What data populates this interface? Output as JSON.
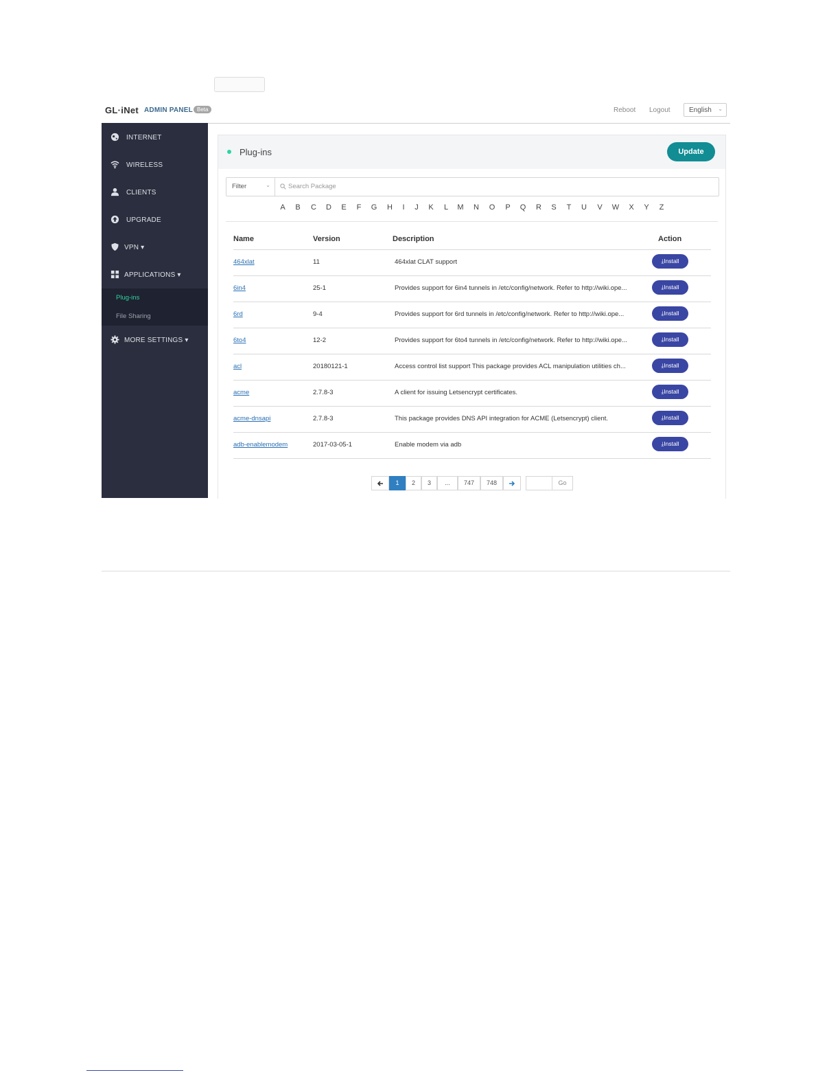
{
  "header": {
    "logo": "GL·iNet",
    "admin_panel": "ADMIN PANEL",
    "beta": "Beta",
    "reboot": "Reboot",
    "logout": "Logout",
    "language": "English"
  },
  "sidebar": {
    "items": [
      {
        "label": "INTERNET",
        "icon": "globe-icon"
      },
      {
        "label": "WIRELESS",
        "icon": "wifi-icon"
      },
      {
        "label": "CLIENTS",
        "icon": "user-icon"
      },
      {
        "label": "UPGRADE",
        "icon": "upgrade-icon"
      },
      {
        "label": "VPN ▾",
        "icon": "shield-icon"
      },
      {
        "label": "APPLICATIONS ▾",
        "icon": "grid-icon"
      },
      {
        "label": "MORE SETTINGS ▾",
        "icon": "gear-icon"
      }
    ],
    "submenu": [
      {
        "label": "Plug-ins",
        "active": true
      },
      {
        "label": "File Sharing",
        "active": false
      }
    ]
  },
  "panel": {
    "title": "Plug-ins",
    "update_label": "Update",
    "filter_label": "Filter",
    "search_placeholder": "Search Package",
    "letters": [
      "A",
      "B",
      "C",
      "D",
      "E",
      "F",
      "G",
      "H",
      "I",
      "J",
      "K",
      "L",
      "M",
      "N",
      "O",
      "P",
      "Q",
      "R",
      "S",
      "T",
      "U",
      "V",
      "W",
      "X",
      "Y",
      "Z"
    ],
    "columns": [
      "Name",
      "Version",
      "Description",
      "Action"
    ],
    "install_label": "Install",
    "rows": [
      {
        "name": "464xlat",
        "version": "11",
        "description": "464xlat CLAT support"
      },
      {
        "name": "6in4",
        "version": "25-1",
        "description": "Provides support for 6in4 tunnels in /etc/config/network. Refer to http://wiki.ope..."
      },
      {
        "name": "6rd",
        "version": "9-4",
        "description": "Provides support for 6rd tunnels in /etc/config/network. Refer to http://wiki.ope..."
      },
      {
        "name": "6to4",
        "version": "12-2",
        "description": "Provides support for 6to4 tunnels in /etc/config/network. Refer to http://wiki.ope..."
      },
      {
        "name": "acl",
        "version": "20180121-1",
        "description": "Access control list support This package provides ACL manipulation utilities ch..."
      },
      {
        "name": "acme",
        "version": "2.7.8-3",
        "description": "A client for issuing Letsencrypt certificates."
      },
      {
        "name": "acme-dnsapi",
        "version": "2.7.8-3",
        "description": "This package provides DNS API integration for ACME (Letsencrypt) client."
      },
      {
        "name": "adb-enablemodem",
        "version": "2017-03-05-1",
        "description": "Enable modem via adb"
      }
    ],
    "pagination": {
      "pages": [
        "1",
        "2",
        "3",
        "...",
        "747",
        "748"
      ],
      "current_page": "1",
      "go_label": "Go"
    }
  },
  "colors": {
    "sidebar_bg": "#2b2e3e",
    "accent_green": "#2dd4a3",
    "update_button": "#118d93",
    "install_button": "#3a46a3",
    "active_page": "#2f7fc1"
  }
}
